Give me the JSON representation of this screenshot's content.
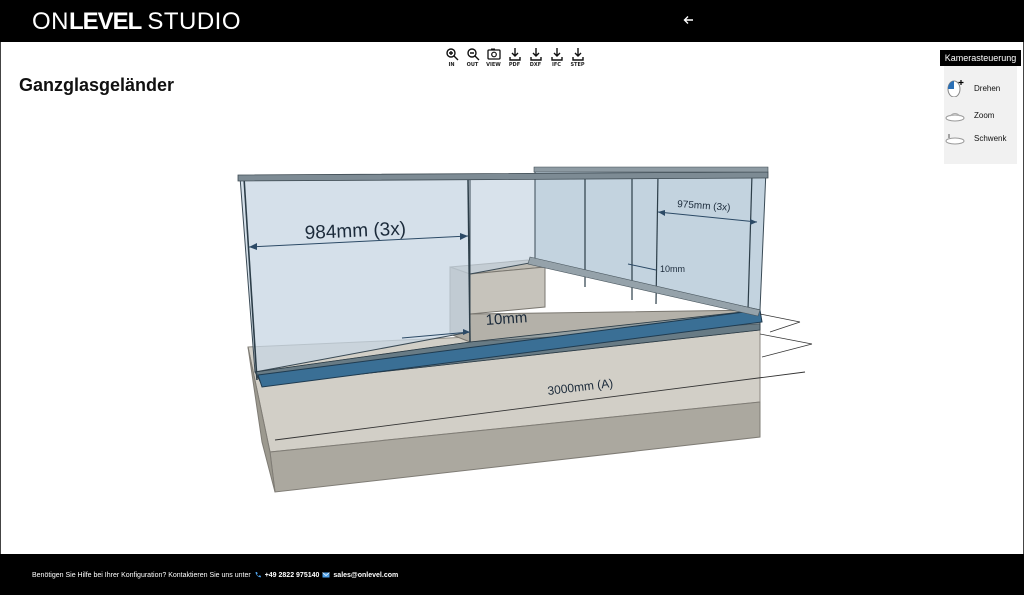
{
  "header": {
    "logo_on": "ON",
    "logo_level": "LEVEL",
    "logo_studio": "STUDIO",
    "back_icon": "arrow-left-icon"
  },
  "toolbar": {
    "items": [
      {
        "label": "IN",
        "icon": "zoom-in-icon"
      },
      {
        "label": "OUT",
        "icon": "zoom-out-icon"
      },
      {
        "label": "VIEW",
        "icon": "camera-icon"
      },
      {
        "label": "PDF",
        "icon": "download-icon"
      },
      {
        "label": "DXF",
        "icon": "download-icon"
      },
      {
        "label": "IFC",
        "icon": "download-icon"
      },
      {
        "label": "STEP",
        "icon": "download-icon"
      }
    ]
  },
  "page": {
    "title": "Ganzglasgeländer"
  },
  "model": {
    "dim_left": "984mm (3x)",
    "dim_right": "975mm (3x)",
    "gap_front": "10mm",
    "gap_right": "10mm",
    "length": "3000mm (A)"
  },
  "camera_panel": {
    "title": "Kamerasteuerung",
    "rotate": "Drehen",
    "zoom": "Zoom",
    "pan": "Schwenk"
  },
  "footer": {
    "help_text": "Benötigen Sie Hilfe bei Ihrer Konfiguration? Kontaktieren Sie uns unter",
    "phone": "+49 2822 975140",
    "email": "sales@onlevel.com"
  },
  "colors": {
    "bar": "#000000",
    "glass": "#c9d8e6",
    "concrete": "#a9a69d",
    "accent": "#2a6fb5"
  }
}
